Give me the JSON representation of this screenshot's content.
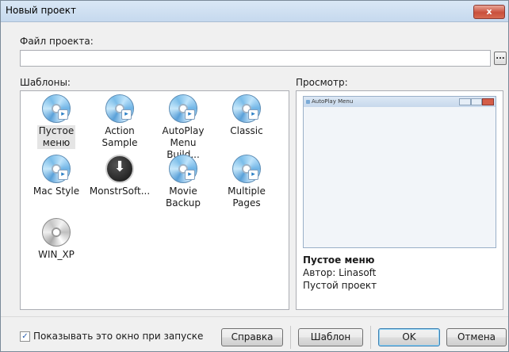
{
  "window": {
    "title": "Новый проект",
    "close_glyph": "x"
  },
  "project_file": {
    "label": "Файл проекта:",
    "value": "",
    "browse_label": "..."
  },
  "templates": {
    "label": "Шаблоны:",
    "items": [
      {
        "line1": "Пустое",
        "line2": "меню",
        "icon": "cd-icon",
        "selected": true
      },
      {
        "line1": "Action",
        "line2": "Sample",
        "icon": "cd-icon"
      },
      {
        "line1": "AutoPlay",
        "line2": "Menu Build...",
        "icon": "cd-icon"
      },
      {
        "line1": "Classic",
        "line2": "",
        "icon": "cd-icon"
      },
      {
        "line1": "Mac Style",
        "line2": "",
        "icon": "cd-icon"
      },
      {
        "line1": "MonstrSoft...",
        "line2": "",
        "icon": "download-icon"
      },
      {
        "line1": "Movie",
        "line2": "Backup",
        "icon": "cd-icon"
      },
      {
        "line1": "Multiple",
        "line2": "Pages",
        "icon": "cd-icon"
      },
      {
        "line1": "WIN_XP",
        "line2": "",
        "icon": "grey-cd-icon"
      }
    ]
  },
  "preview": {
    "label": "Просмотр:",
    "window_title": "AutoPlay Menu",
    "name": "Пустое меню",
    "author": "Автор:  Linasoft",
    "description": "Пустой проект"
  },
  "footer": {
    "show_on_start_label": "Показывать это окно при запуске",
    "show_on_start_checked": true,
    "check_glyph": "✓",
    "help_button": "Справка",
    "template_button": "Шаблон",
    "ok_button": "OK",
    "cancel_button": "Отмена"
  },
  "colors": {
    "title_bar": "#c6d9ee",
    "close_button": "#c9503c",
    "accent": "#3c7fb1"
  }
}
